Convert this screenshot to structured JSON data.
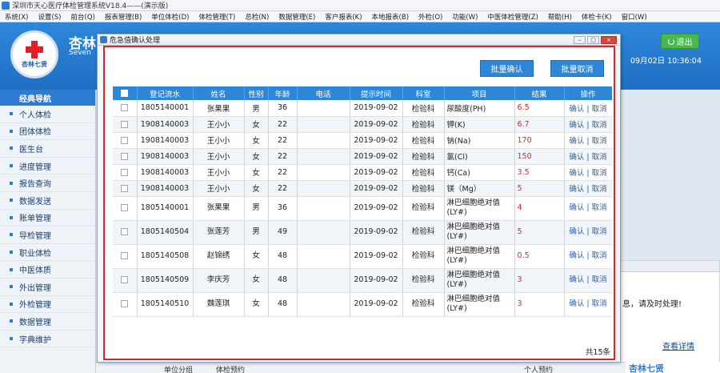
{
  "app": {
    "title": "深圳市天心医疗体检管理系统V18.4——(演示版)",
    "menu": [
      "系统(X)",
      "设置(S)",
      "前台(Q)",
      "报表管理(B)",
      "单位体检(D)",
      "体检管理(T)",
      "总检(N)",
      "数据管理(E)",
      "客户报表(K)",
      "本地报表(B)",
      "外检(O)",
      "功能(W)",
      "中医体检管理(Z)",
      "帮助(H)",
      "体检卡(K)",
      "窗口(W)"
    ]
  },
  "header": {
    "brand_name": "杏林",
    "brand_en": "Seven",
    "logo_text": "杏林七贤",
    "exit_label": "退出",
    "datetime": "09月02日 10:36:04"
  },
  "sidebar": {
    "head": "经典导航",
    "items": [
      "个人体检",
      "团体体检",
      "医生台",
      "进度管理",
      "报告查询",
      "数据发送",
      "账单管理",
      "导检管理",
      "职业体检",
      "中医体质",
      "外出管理",
      "外检管理",
      "数据管理",
      "字典维护"
    ]
  },
  "background": {
    "message": "息，请及时处理!",
    "link": "查看详情",
    "bottom_texts": [
      "单位分组",
      "体检预约",
      "个人预约"
    ],
    "bottom_logo": "杏林七贤"
  },
  "dialog": {
    "title": "危急值确认处理",
    "batch_confirm": "批量确认",
    "batch_cancel": "批量取消",
    "columns": [
      "",
      "登记流水",
      "姓名",
      "性别",
      "年龄",
      "电话",
      "提示时间",
      "科室",
      "项目",
      "结果",
      "操作"
    ],
    "rows": [
      {
        "id": "1805140001",
        "name": "张果果",
        "sex": "男",
        "age": "36",
        "phone": "",
        "time": "2019-09-02",
        "dept": "检验科",
        "item": "尿酸度(PH)",
        "result": "6.5",
        "tall": false
      },
      {
        "id": "1908140003",
        "name": "王小小",
        "sex": "女",
        "age": "22",
        "phone": "",
        "time": "2019-09-02",
        "dept": "检验科",
        "item": "钾(K)",
        "result": "6.7",
        "tall": false
      },
      {
        "id": "1908140003",
        "name": "王小小",
        "sex": "女",
        "age": "22",
        "phone": "",
        "time": "2019-09-02",
        "dept": "检验科",
        "item": "钠(Na)",
        "result": "170",
        "tall": false
      },
      {
        "id": "1908140003",
        "name": "王小小",
        "sex": "女",
        "age": "22",
        "phone": "",
        "time": "2019-09-02",
        "dept": "检验科",
        "item": "氯(Cl)",
        "result": "150",
        "tall": false
      },
      {
        "id": "1908140003",
        "name": "王小小",
        "sex": "女",
        "age": "22",
        "phone": "",
        "time": "2019-09-02",
        "dept": "检验科",
        "item": "钙(Ca)",
        "result": "3.5",
        "tall": false
      },
      {
        "id": "1908140003",
        "name": "王小小",
        "sex": "女",
        "age": "22",
        "phone": "",
        "time": "2019-09-02",
        "dept": "检验科",
        "item": "镁（Mg）",
        "result": "5",
        "tall": false
      },
      {
        "id": "1805140001",
        "name": "张果果",
        "sex": "男",
        "age": "36",
        "phone": "",
        "time": "2019-09-02",
        "dept": "检验科",
        "item": "淋巴细胞绝对值(LY#)",
        "result": "4",
        "tall": true
      },
      {
        "id": "1805140504",
        "name": "张莲芳",
        "sex": "男",
        "age": "49",
        "phone": "",
        "time": "2019-09-02",
        "dept": "检验科",
        "item": "淋巴细胞绝对值(LY#)",
        "result": "5",
        "tall": true
      },
      {
        "id": "1805140508",
        "name": "赵锦绣",
        "sex": "女",
        "age": "48",
        "phone": "",
        "time": "2019-09-02",
        "dept": "检验科",
        "item": "淋巴细胞绝对值(LY#)",
        "result": "0.5",
        "tall": true
      },
      {
        "id": "1805140509",
        "name": "李庆芳",
        "sex": "女",
        "age": "48",
        "phone": "",
        "time": "2019-09-02",
        "dept": "检验科",
        "item": "淋巴细胞绝对值(LY#)",
        "result": "3",
        "tall": true
      },
      {
        "id": "1805140510",
        "name": "魏莲琪",
        "sex": "女",
        "age": "48",
        "phone": "",
        "time": "2019-09-02",
        "dept": "检验科",
        "item": "淋巴细胞绝对值(LY#)",
        "result": "3",
        "tall": true
      }
    ],
    "op_confirm": "确认",
    "op_cancel": "取消",
    "total": "共15条"
  },
  "colors": {
    "accent": "#2e86d6",
    "highlight_border": "#e02424",
    "result": "#e02424",
    "exit": "#4bb84f"
  }
}
